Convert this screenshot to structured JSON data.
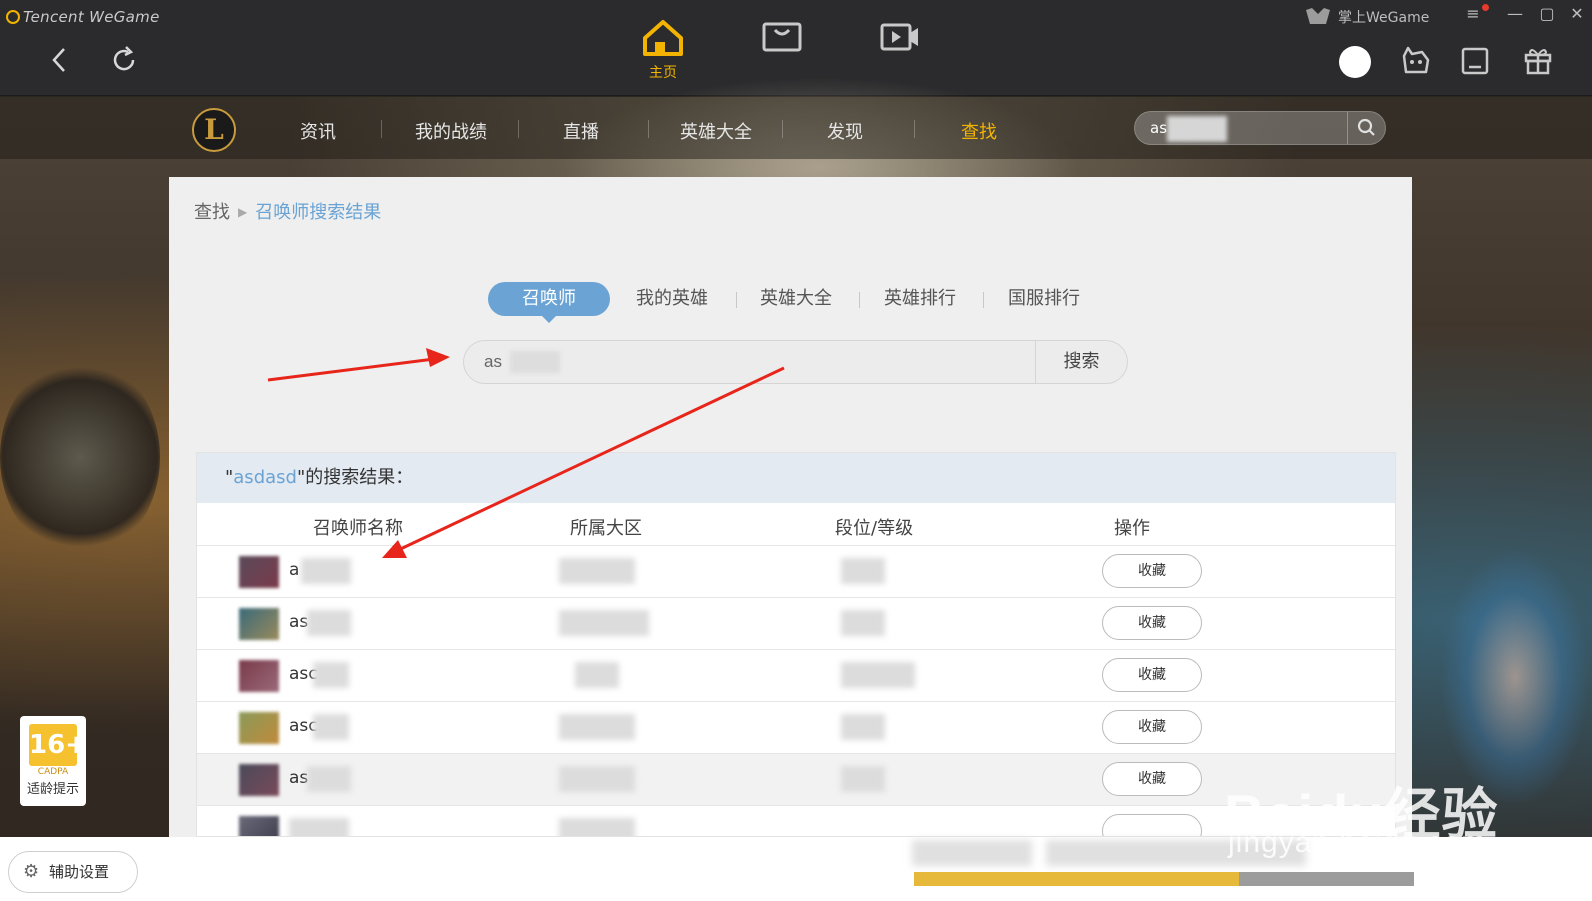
{
  "app": {
    "brand": "Tencent WeGame",
    "mobile_label": "掌上WeGame",
    "main_tabs": [
      {
        "label": "主页",
        "icon": "home-icon",
        "active": true
      },
      {
        "label": "",
        "icon": "store-icon",
        "active": false
      },
      {
        "label": "",
        "icon": "video-icon",
        "active": false
      }
    ],
    "window_controls": [
      "menu-icon",
      "minimize-icon",
      "maximize-icon",
      "close-icon"
    ],
    "accent": "#f2b400"
  },
  "lol_nav": {
    "logo": "L",
    "items": [
      "资讯",
      "我的战绩",
      "直播",
      "英雄大全",
      "发现",
      "查找"
    ],
    "active_index": 5,
    "search_value": "as"
  },
  "breadcrumb": {
    "root": "查找",
    "current": "召唤师搜索结果"
  },
  "search_tabs": {
    "items": [
      "召唤师",
      "我的英雄",
      "英雄大全",
      "英雄排行",
      "国服排行"
    ],
    "active_index": 0
  },
  "search": {
    "value": "as",
    "button": "搜索"
  },
  "results": {
    "heading_prefix": "\"",
    "keyword": "asdasd",
    "heading_suffix": "\"的搜索结果：",
    "columns": [
      "召唤师名称",
      "所属大区",
      "段位/等级",
      "操作"
    ],
    "rows": [
      {
        "name": "a",
        "action": "收藏"
      },
      {
        "name": "as",
        "action": "收藏"
      },
      {
        "name": "asc",
        "action": "收藏"
      },
      {
        "name": "asc",
        "action": "收藏"
      },
      {
        "name": "as",
        "action": "收藏"
      },
      {
        "name": "",
        "action": ""
      }
    ],
    "accent": "#6aa3d4"
  },
  "bottom": {
    "assist_label": "辅助设置",
    "download_progress": 0.65
  },
  "age_rating": {
    "rating": "16+",
    "org": "CADPA",
    "tip": "适龄提示"
  },
  "watermark": {
    "brand": "Baidu经验",
    "url": "jingyan.baidu.com"
  }
}
